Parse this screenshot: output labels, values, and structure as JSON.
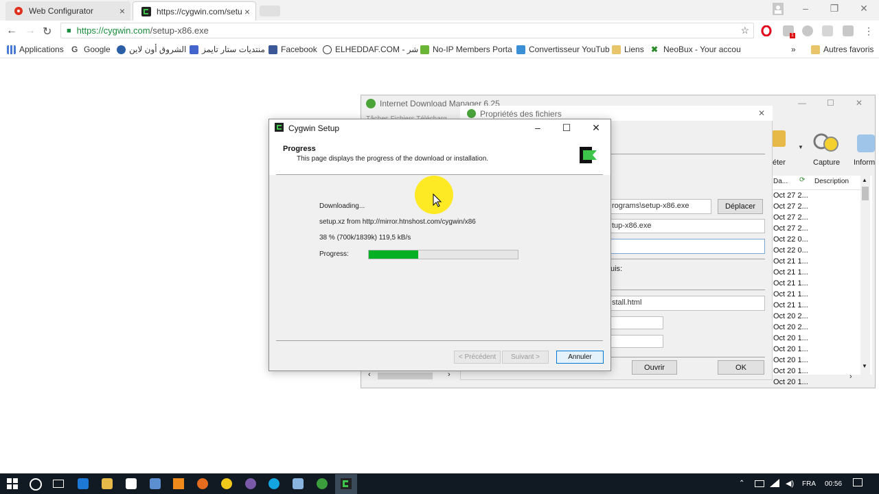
{
  "browser": {
    "tabs": [
      {
        "title": "Web Configurator",
        "icon": "huawei-icon"
      },
      {
        "title": "https://cygwin.com/setu",
        "icon": "cygwin-icon",
        "active": true
      }
    ],
    "address": {
      "secure_host": "https://cygwin.com",
      "path": "/setup-x86.exe"
    },
    "bookmarks": [
      {
        "label": "Applications",
        "icon": "apps-grid-icon"
      },
      {
        "label": "Google",
        "icon": "google-icon"
      },
      {
        "label": "الشروق أون لاين",
        "icon": "globe-icon"
      },
      {
        "label": "منتديات ستار تايمز",
        "icon": "star-icon"
      },
      {
        "label": "Facebook",
        "icon": "facebook-icon"
      },
      {
        "label": "ELHEDDAF.COM - شر",
        "icon": "soccer-icon"
      },
      {
        "label": "No-IP Members Porta",
        "icon": "noip-icon"
      },
      {
        "label": "Convertisseur YouTub",
        "icon": "convert-icon"
      },
      {
        "label": "Liens",
        "icon": "folder-icon"
      },
      {
        "label": "NeoBux - Your accou",
        "icon": "neobux-icon"
      }
    ],
    "other_bookmarks": "Autres favoris",
    "overflow": "»"
  },
  "idm": {
    "title": "Internet Download Manager 6.25",
    "props_title": "Propriétés des fichiers",
    "menu_partial": "Tâches   Fichiers   Télécharg",
    "toolbar": [
      {
        "label": "éter"
      },
      {
        "label": "Capture"
      },
      {
        "label": "Inform"
      }
    ],
    "columns": {
      "date": "Da...",
      "description": "Description"
    },
    "save_path": "rograms\\setup-x86.exe",
    "move_button": "Déplacer",
    "file_name": "tup-x86.exe",
    "depuis_label": "uis:",
    "referer": "stall.html",
    "open_button": "Ouvrir",
    "ok_button": "OK",
    "dates": [
      "Oct 27 2...",
      "Oct 27 2...",
      "Oct 27 2...",
      "Oct 27 2...",
      "Oct 22 0...",
      "Oct 22 0...",
      "Oct 21 1...",
      "Oct 21 1...",
      "Oct 21 1...",
      "Oct 21 1...",
      "Oct 21 1...",
      "Oct 20 2...",
      "Oct 20 2...",
      "Oct 20 1...",
      "Oct 20 1...",
      "Oct 20 1...",
      "Oct 20 1...",
      "Oct 20 1..."
    ]
  },
  "cygwin": {
    "title": "Cygwin Setup",
    "page_title": "Progress",
    "page_desc": "This page displays the progress of the download or installation.",
    "status": "Downloading...",
    "file_line": "setup.xz from http://mirror.htnshost.com/cygwin/x86",
    "stats": "38 %  (700k/1839k)  119,5 kB/s",
    "progress_label": "Progress:",
    "progress": 0.33,
    "back_button": "< Précédent",
    "next_button": "Suivant >",
    "cancel_button": "Annuler"
  },
  "taskbar": {
    "language": "FRA",
    "time": "00:56"
  }
}
